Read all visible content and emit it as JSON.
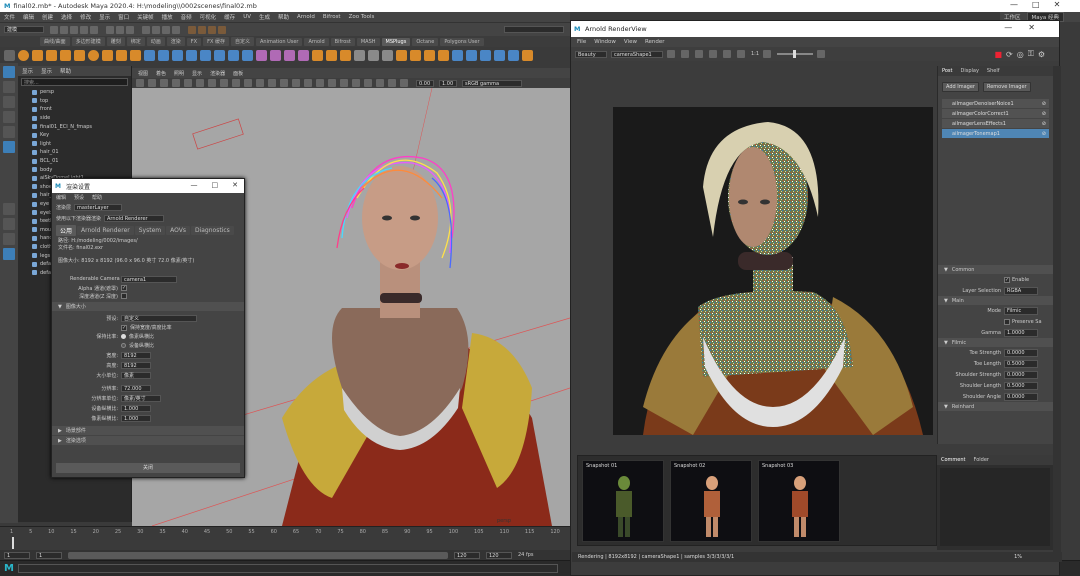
{
  "window": {
    "title": "final02.mb* - Autodesk Maya 2020.4: H:\\modeling\\\\0002scenes\\final02.mb",
    "minimize": "—",
    "maximize": "□",
    "close": "✕"
  },
  "main_menu": [
    "文件",
    "编辑",
    "创建",
    "选择",
    "修改",
    "显示",
    "窗口",
    "关键帧",
    "播放",
    "音频",
    "可视化",
    "缓存",
    "Arnold",
    "Bifrost",
    "Zoo Tools"
  ],
  "right_menu": [
    "工作区",
    "Maya 经典"
  ],
  "menu_extra": [
    "UV",
    "生成",
    "帮助"
  ],
  "workspace_select": "建模",
  "shelf_tabs": [
    "曲线/曲面",
    "多边形建模",
    "雕刻",
    "绑定",
    "动画",
    "渲染",
    "FX",
    "FX 缓存",
    "自定义",
    "Animation User",
    "Arnold",
    "Bifrost",
    "MASH",
    "MSPlugs",
    "Octane",
    "Polygons User"
  ],
  "outliner": {
    "menu": [
      "显示",
      "显示",
      "帮助"
    ],
    "search_placeholder": "搜索...",
    "items": [
      "persp",
      "top",
      "front",
      "side",
      "final01_ECI_N_fmaps",
      "Key",
      "light",
      "hair_01",
      "BCL_01",
      "body",
      "aiSkyDomeLight1",
      "shoe",
      "hair_02",
      "eye",
      "eyebrow",
      "teeth",
      "mouth",
      "hand",
      "cloth",
      "legs",
      "defaultLightSet",
      "defaultObjectSet"
    ]
  },
  "viewport": {
    "menu": [
      "视图",
      "着色",
      "照明",
      "显示",
      "渲染器",
      "面板"
    ],
    "gamma": "sRGB gamma",
    "exposure": "0.00",
    "gamma_value": "1.00",
    "cam_label": "persp"
  },
  "timeline": {
    "ticks": [
      "1",
      "5",
      "10",
      "15",
      "20",
      "25",
      "30",
      "35",
      "40",
      "45",
      "50",
      "55",
      "60",
      "65",
      "70",
      "75",
      "80",
      "85",
      "90",
      "95",
      "100",
      "105",
      "110",
      "115",
      "120"
    ],
    "start": "1",
    "end": "120",
    "range_end": "120",
    "current": "1",
    "fps": "24 fps"
  },
  "render_settings_dialog": {
    "title": "渲染设置",
    "menu": [
      "编辑",
      "预设",
      "帮助"
    ],
    "layer_label": "渲染层",
    "layer_value": "masterLayer",
    "renderer_label": "使用以下渲染器渲染",
    "renderer_value": "Arnold Renderer",
    "tabs": [
      "公用",
      "Arnold Renderer",
      "System",
      "AOVs",
      "Diagnostics"
    ],
    "path_line": "路径: H:/modeling/0002/images/",
    "file_line": "文件名: final02.exr",
    "size_line": "图像大小: 8192 x 8192 (96.0 x 96.0 英寸 72.0 像素/英寸)",
    "camera_label": "Renderable Camera",
    "camera_value": "camera1",
    "alpha_label": "Alpha 通道(遮罩)",
    "depth_label": "深度通道(Z 深度)",
    "section_image_size": "图像大小",
    "preset_label": "预设:",
    "preset_value": "自定义",
    "maintain_ratio": "保持宽度/高度比率",
    "ratio_label": "保持比率:",
    "pixel_aspect": "像素纵横比",
    "device_aspect": "设备纵横比",
    "width_label": "宽度:",
    "width_value": "8192",
    "height_label": "高度:",
    "height_value": "8192",
    "unit_label": "大小单位:",
    "unit_value": "像素",
    "res_label": "分辨率:",
    "res_value": "72.000",
    "res_unit_label": "分辨率单位:",
    "res_unit_value": "像素/英寸",
    "dev_ratio_label": "设备纵横比:",
    "dev_ratio_value": "1.000",
    "px_ratio_label": "像素纵横比:",
    "px_ratio_value": "1.000",
    "section_scene_assembly": "场景部件",
    "section_render_options": "渲染选项",
    "close_button": "关闭"
  },
  "arnold_renderview": {
    "title": "Arnold RenderView",
    "menu": [
      "File",
      "Window",
      "View",
      "Render"
    ],
    "aov_select": "Beauty",
    "camera_select": "cameraShape1",
    "ratio": "1:1",
    "panel_tabs": [
      "Post",
      "Display",
      "Shelf"
    ],
    "add_imager": "Add Imager",
    "remove_imager": "Remove Imager",
    "imagers": [
      "aiImagerDenoiserNoice1",
      "aiImagerColorCorrect1",
      "aiImagerLensEffects1",
      "aiImagerTonemap1"
    ],
    "selected_imager_index": 3,
    "section_common": "Common",
    "enable_label": "Enable",
    "layer_selection_label": "Layer Selection",
    "layer_selection_value": "RGBA",
    "section_main": "Main",
    "mode_label": "Mode",
    "mode_value": "Filmic",
    "preserve_label": "Preserve Sa",
    "gamma_label": "Gamma",
    "gamma_value": "1.0000",
    "section_filmic": "Filmic",
    "toe_strength_label": "Toe Strength",
    "toe_strength_value": "0.0000",
    "toe_length_label": "Toe Length",
    "toe_length_value": "0.5000",
    "shoulder_strength_label": "Shoulder Strength",
    "shoulder_strength_value": "0.0000",
    "shoulder_length_label": "Shoulder Length",
    "shoulder_length_value": "0.5000",
    "shoulder_angle_label": "Shoulder Angle",
    "shoulder_angle_value": "0.0000",
    "section_reinhard": "Reinhard",
    "bottom_tabs": [
      "Comment",
      "Folder"
    ],
    "snapshots": [
      "Snapshot 01",
      "Snapshot 02",
      "Snapshot 03"
    ],
    "status": "Rendering | 8192x8192 | cameraShape1 | samples 3/3/3/3/3/1",
    "zoom": "1%"
  },
  "logo": "M",
  "colors": {
    "accent": "#3d7fb8",
    "selected": "#4f86b5"
  }
}
